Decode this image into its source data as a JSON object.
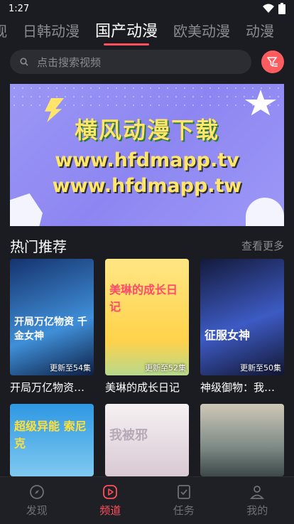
{
  "status_bar": {
    "time": "1:27"
  },
  "tabs": [
    {
      "label": "视",
      "active": false
    },
    {
      "label": "日韩动漫",
      "active": false
    },
    {
      "label": "国产动漫",
      "active": true
    },
    {
      "label": "欧美动漫",
      "active": false
    },
    {
      "label": "动漫",
      "active": false
    }
  ],
  "search": {
    "placeholder": "点击搜索视频"
  },
  "banner": {
    "title": "横风动漫下载",
    "url1": "www.hfdmapp.tv",
    "url2": "www.hfdmapp.tw"
  },
  "section": {
    "title": "热门推荐",
    "more": "查看更多"
  },
  "cards": [
    {
      "name": "开局万亿物资：千金女神都想...",
      "badge": "更新至54集",
      "poster_text": "开局万亿物资 千金女神",
      "colors": [
        "#1b3c7a",
        "#5fb0e8"
      ]
    },
    {
      "name": "美琳的成长日记",
      "badge": "更新至52集",
      "poster_text": "美琳的成长日记",
      "colors": [
        "#ffe27a",
        "#ffd04a"
      ]
    },
    {
      "name": "神级御物：我的女神...",
      "badge": "更新至50集",
      "poster_text": "征服女神",
      "colors": [
        "#1a1f4a",
        "#4a6bd4"
      ]
    },
    {
      "name": "",
      "badge": "",
      "poster_text": "超级异能 索尼克",
      "colors": [
        "#3aa0e6",
        "#8fd4f2"
      ]
    },
    {
      "name": "",
      "badge": "",
      "poster_text": "我被邪",
      "colors": [
        "#f3eef0",
        "#c9b5c4"
      ]
    },
    {
      "name": "",
      "badge": "",
      "poster_text": "",
      "colors": [
        "#c9c3b4",
        "#5a6a6e"
      ]
    }
  ],
  "bottom_nav": [
    {
      "label": "发现",
      "icon": "compass-icon",
      "active": false
    },
    {
      "label": "频道",
      "icon": "play-icon",
      "active": true
    },
    {
      "label": "任务",
      "icon": "checklist-icon",
      "active": false
    },
    {
      "label": "我的",
      "icon": "person-icon",
      "active": false
    }
  ]
}
